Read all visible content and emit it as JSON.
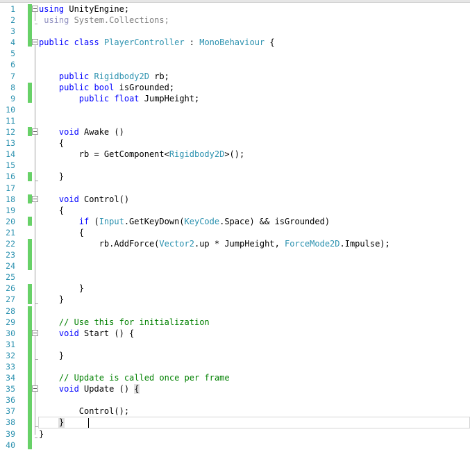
{
  "editor": {
    "name": "visual-studio-code-editor",
    "language": "C#",
    "file_kind": "unity-script",
    "total_lines": 40,
    "current_line": 38,
    "caret_line": 38,
    "caret_column": 10,
    "colors": {
      "background": "#ffffff",
      "keyword": "#0000ff",
      "type": "#2b91af",
      "comment": "#008000",
      "plain_text": "#000000",
      "line_number": "#2b91af",
      "unused_using": "#808080",
      "change_bar_saved": "#68d168",
      "fold_guide": "#a0a0a0",
      "current_line_border": "#d4d4d4",
      "brace_match_highlight": "#e0e0e0"
    },
    "line_numbers": [
      "1",
      "2",
      "3",
      "4",
      "5",
      "6",
      "7",
      "8",
      "9",
      "10",
      "11",
      "12",
      "13",
      "14",
      "15",
      "16",
      "17",
      "18",
      "19",
      "20",
      "21",
      "22",
      "23",
      "24",
      "25",
      "26",
      "27",
      "28",
      "29",
      "30",
      "31",
      "32",
      "33",
      "34",
      "35",
      "36",
      "37",
      "38",
      "39",
      "40"
    ],
    "lines": [
      {
        "n": 1,
        "text": "using UnityEngine;"
      },
      {
        "n": 2,
        "text": " using System.Collections;"
      },
      {
        "n": 3,
        "text": ""
      },
      {
        "n": 4,
        "text": "public class PlayerController : MonoBehaviour {"
      },
      {
        "n": 5,
        "text": ""
      },
      {
        "n": 6,
        "text": ""
      },
      {
        "n": 7,
        "text": "    public Rigidbody2D rb;"
      },
      {
        "n": 8,
        "text": "    public bool isGrounded;"
      },
      {
        "n": 9,
        "text": "        public float JumpHeight;"
      },
      {
        "n": 10,
        "text": ""
      },
      {
        "n": 11,
        "text": ""
      },
      {
        "n": 12,
        "text": "    void Awake ()"
      },
      {
        "n": 13,
        "text": "    {"
      },
      {
        "n": 14,
        "text": "        rb = GetComponent<Rigidbody2D>();"
      },
      {
        "n": 15,
        "text": ""
      },
      {
        "n": 16,
        "text": "    }"
      },
      {
        "n": 17,
        "text": ""
      },
      {
        "n": 18,
        "text": "    void Control()"
      },
      {
        "n": 19,
        "text": "    {"
      },
      {
        "n": 20,
        "text": "        if (Input.GetKeyDown(KeyCode.Space) && isGrounded)"
      },
      {
        "n": 21,
        "text": "        {"
      },
      {
        "n": 22,
        "text": "            rb.AddForce(Vector2.up * JumpHeight, ForceMode2D.Impulse);"
      },
      {
        "n": 23,
        "text": ""
      },
      {
        "n": 24,
        "text": ""
      },
      {
        "n": 25,
        "text": ""
      },
      {
        "n": 26,
        "text": "        }"
      },
      {
        "n": 27,
        "text": "    }"
      },
      {
        "n": 28,
        "text": ""
      },
      {
        "n": 29,
        "text": "    // Use this for initialization"
      },
      {
        "n": 30,
        "text": "    void Start () {"
      },
      {
        "n": 31,
        "text": ""
      },
      {
        "n": 32,
        "text": "    }"
      },
      {
        "n": 33,
        "text": ""
      },
      {
        "n": 34,
        "text": "    // Update is called once per frame"
      },
      {
        "n": 35,
        "text": "    void Update () {"
      },
      {
        "n": 36,
        "text": ""
      },
      {
        "n": 37,
        "text": "        Control();"
      },
      {
        "n": 38,
        "text": "    }"
      },
      {
        "n": 39,
        "text": "}"
      },
      {
        "n": 40,
        "text": ""
      }
    ],
    "fold_markers": [
      {
        "line": 1,
        "state": "expanded"
      },
      {
        "line": 4,
        "state": "expanded"
      },
      {
        "line": 12,
        "state": "expanded"
      },
      {
        "line": 18,
        "state": "expanded"
      },
      {
        "line": 30,
        "state": "expanded"
      },
      {
        "line": 35,
        "state": "expanded"
      }
    ],
    "change_bars": [
      {
        "from_line": 1,
        "to_line": 4
      },
      {
        "from_line": 8,
        "to_line": 9
      },
      {
        "from_line": 12,
        "to_line": 12
      },
      {
        "from_line": 16,
        "to_line": 16
      },
      {
        "from_line": 18,
        "to_line": 18
      },
      {
        "from_line": 20,
        "to_line": 20
      },
      {
        "from_line": 22,
        "to_line": 24
      },
      {
        "from_line": 26,
        "to_line": 27
      },
      {
        "from_line": 28,
        "to_line": 40
      }
    ],
    "brace_match": [
      {
        "line": 35,
        "char": "{"
      },
      {
        "line": 38,
        "char": "}"
      }
    ]
  }
}
